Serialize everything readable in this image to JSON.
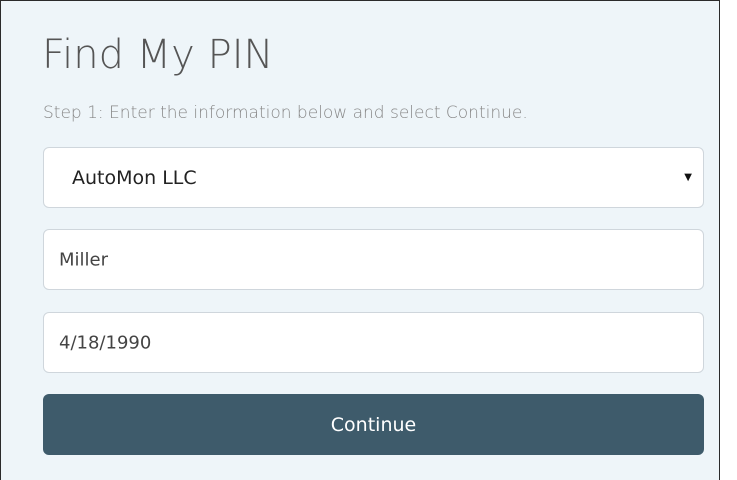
{
  "form": {
    "title": "Find My PIN",
    "subtitle": "Step 1: Enter the information below and select Continue.",
    "employer_select": {
      "value": "AutoMon LLC",
      "arrow_icon": "caret-down-icon"
    },
    "last_name_field": {
      "value": "Miller"
    },
    "dob_field": {
      "value": "4/18/1990"
    },
    "continue_label": "Continue"
  },
  "colors": {
    "panel_background": "#eef5f9",
    "button_background": "#3e5b6b",
    "button_text": "#ffffff",
    "title_text": "#555555",
    "subtitle_text": "#888888",
    "field_border": "#cfd6dc"
  }
}
